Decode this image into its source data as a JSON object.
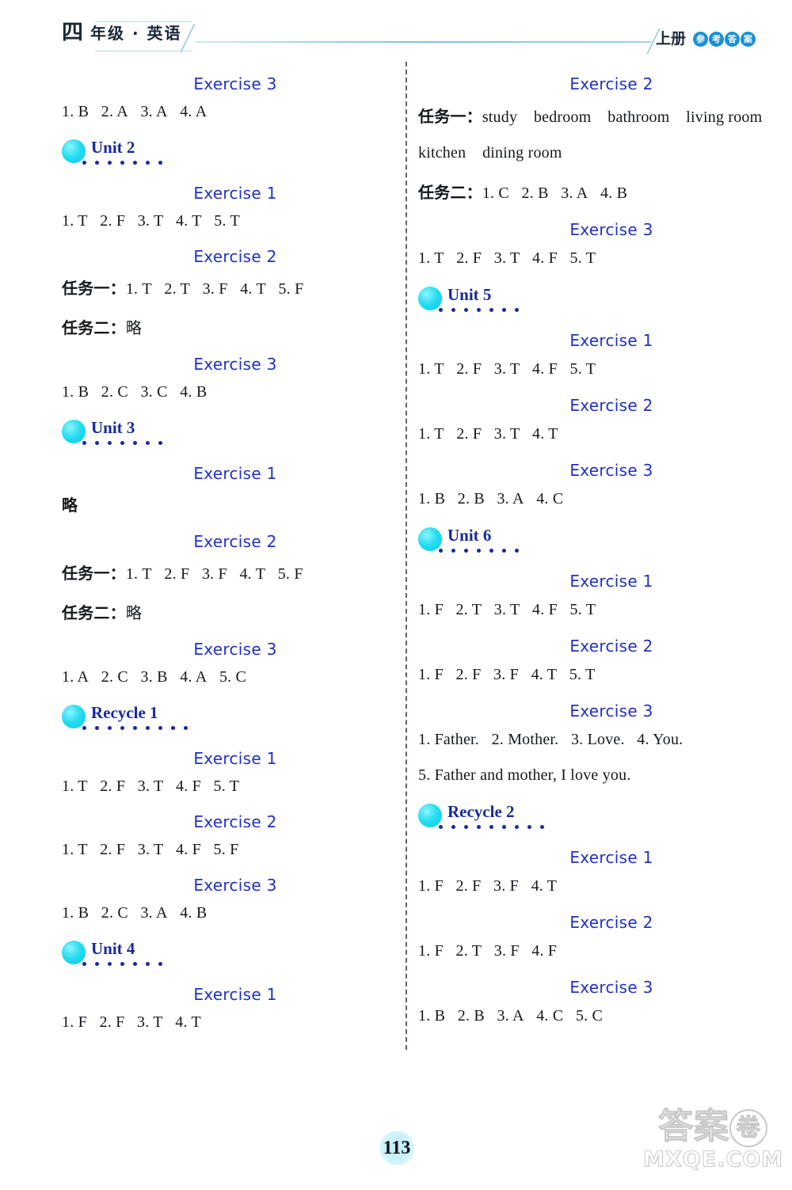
{
  "header": {
    "grade": "四",
    "subject": "年级 · 英语",
    "volume": "上册",
    "answer_key_chars": [
      "参",
      "考",
      "答",
      "案"
    ]
  },
  "colors": {
    "exercise_heading": "#2031c8",
    "unit_label": "#182a9e",
    "unit_bubble": "#22dcf0",
    "answer_text": "#15181c",
    "divider": "#5c6470"
  },
  "left_column": [
    {
      "kind": "exercise",
      "label": "Exercise 3",
      "indent": "ind2"
    },
    {
      "kind": "answer",
      "text": "1. B   2. A   3. A   4. A"
    },
    {
      "kind": "unit",
      "label": "Unit 2",
      "dots": 7
    },
    {
      "kind": "exercise",
      "label": "Exercise 1",
      "indent": "ind2"
    },
    {
      "kind": "answer",
      "text": "1. T   2. F   3. T   4. T   5. T"
    },
    {
      "kind": "exercise",
      "label": "Exercise 2",
      "indent": "ind2"
    },
    {
      "kind": "answer",
      "prefix": "任务一：",
      "text": "1. T   2. T   3. F   4. T   5. F"
    },
    {
      "kind": "answer",
      "prefix": "任务二：",
      "text": "略"
    },
    {
      "kind": "exercise",
      "label": "Exercise 3",
      "indent": "ind2"
    },
    {
      "kind": "answer",
      "text": "1. B   2. C   3. C   4. B"
    },
    {
      "kind": "unit",
      "label": "Unit 3",
      "dots": 7
    },
    {
      "kind": "exercise",
      "label": "Exercise 1",
      "indent": "ind2"
    },
    {
      "kind": "answer",
      "prefix": "略",
      "text": ""
    },
    {
      "kind": "exercise",
      "label": "Exercise 2",
      "indent": "ind2"
    },
    {
      "kind": "answer",
      "prefix": "任务一：",
      "text": "1. T   2. F   3. F   4. T   5. F"
    },
    {
      "kind": "answer",
      "prefix": "任务二：",
      "text": "略"
    },
    {
      "kind": "exercise",
      "label": "Exercise 3",
      "indent": "ind2"
    },
    {
      "kind": "answer",
      "text": "1. A   2. C   3. B   4. A   5. C"
    },
    {
      "kind": "unit",
      "label": "Recycle 1",
      "dots": 9
    },
    {
      "kind": "exercise",
      "label": "Exercise 1",
      "indent": "ind2"
    },
    {
      "kind": "answer",
      "text": "1. T   2. F   3. T   4. F   5. T"
    },
    {
      "kind": "exercise",
      "label": "Exercise 2",
      "indent": "ind2"
    },
    {
      "kind": "answer",
      "text": "1. T   2. F   3. T   4. F   5. F"
    },
    {
      "kind": "exercise",
      "label": "Exercise 3",
      "indent": "ind2"
    },
    {
      "kind": "answer",
      "text": "1. B   2. C   3. A   4. B"
    },
    {
      "kind": "unit",
      "label": "Unit 4",
      "dots": 7
    },
    {
      "kind": "exercise",
      "label": "Exercise 1",
      "indent": "ind2"
    },
    {
      "kind": "answer",
      "text": "1. F   2. F   3. T   4. T"
    }
  ],
  "right_column": [
    {
      "kind": "exercise",
      "label": "Exercise 2",
      "indent": "ind1"
    },
    {
      "kind": "answer",
      "prefix": "任务一：",
      "text": "study    bedroom    bathroom    living room"
    },
    {
      "kind": "answer",
      "text": "kitchen    dining room"
    },
    {
      "kind": "answer",
      "prefix": "任务二：",
      "text": "1. C   2. B   3. A   4. B"
    },
    {
      "kind": "exercise",
      "label": "Exercise 3",
      "indent": "ind1"
    },
    {
      "kind": "answer",
      "text": "1. T   2. F   3. T   4. F   5. T"
    },
    {
      "kind": "unit",
      "label": "Unit 5",
      "dots": 7
    },
    {
      "kind": "exercise",
      "label": "Exercise 1",
      "indent": "ind1"
    },
    {
      "kind": "answer",
      "text": "1. T   2. F   3. T   4. F   5. T"
    },
    {
      "kind": "exercise",
      "label": "Exercise 2",
      "indent": "ind1"
    },
    {
      "kind": "answer",
      "text": "1. T   2. F   3. T   4. T"
    },
    {
      "kind": "exercise",
      "label": "Exercise 3",
      "indent": "ind1"
    },
    {
      "kind": "answer",
      "text": "1. B   2. B   3. A   4. C"
    },
    {
      "kind": "unit",
      "label": "Unit 6",
      "dots": 7
    },
    {
      "kind": "exercise",
      "label": "Exercise 1",
      "indent": "ind1"
    },
    {
      "kind": "answer",
      "text": "1. F   2. T   3. T   4. F   5. T"
    },
    {
      "kind": "exercise",
      "label": "Exercise 2",
      "indent": "ind1"
    },
    {
      "kind": "answer",
      "text": "1. F   2. F   3. F   4. T   5. T"
    },
    {
      "kind": "exercise",
      "label": "Exercise 3",
      "indent": "ind1"
    },
    {
      "kind": "answer",
      "text": "1. Father.   2. Mother.   3. Love.   4. You."
    },
    {
      "kind": "answer",
      "text": "5. Father and mother, I love you."
    },
    {
      "kind": "unit",
      "label": "Recycle 2",
      "dots": 9
    },
    {
      "kind": "exercise",
      "label": "Exercise 1",
      "indent": "ind1"
    },
    {
      "kind": "answer",
      "text": "1. F   2. F   3. F   4. T"
    },
    {
      "kind": "exercise",
      "label": "Exercise 2",
      "indent": "ind1"
    },
    {
      "kind": "answer",
      "text": "1. F   2. T   3. F   4. F"
    },
    {
      "kind": "exercise",
      "label": "Exercise 3",
      "indent": "ind1"
    },
    {
      "kind": "answer",
      "text": "1. B   2. B   3. A   4. C   5. C"
    }
  ],
  "footer": {
    "page_number": "113",
    "watermark_cjk": "答案",
    "watermark_cjk_circle": "卷",
    "watermark_domain": "MXQE.COM"
  }
}
